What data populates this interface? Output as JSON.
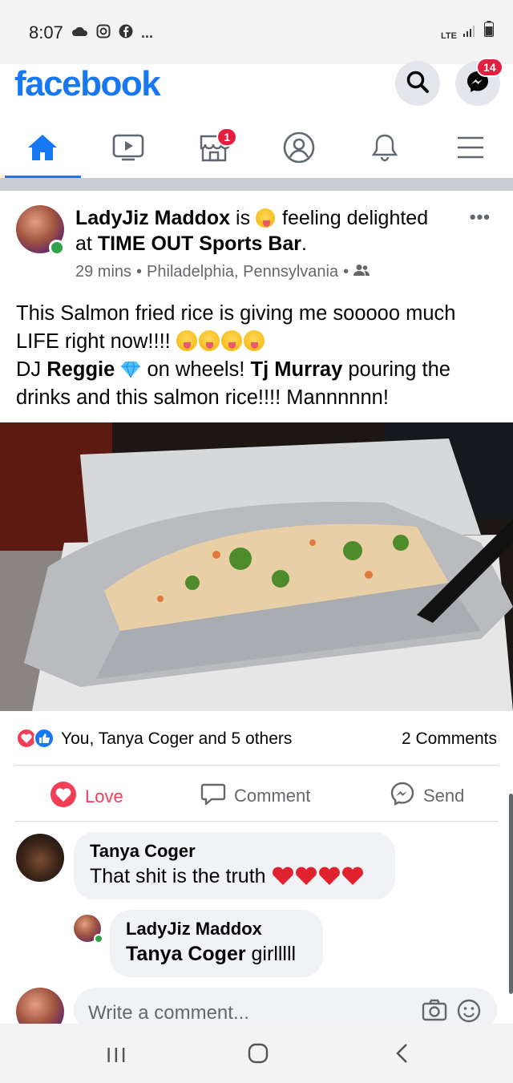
{
  "status_bar": {
    "time": "8:07",
    "left_icons": [
      "cloud-icon",
      "instagram-icon",
      "facebook-icon",
      "more-icon"
    ],
    "network": "LTE",
    "more_indicator": "..."
  },
  "header": {
    "logo": "facebook",
    "messenger_badge": "14",
    "colors": {
      "brand": "#1877f2",
      "badge": "#e41e3f"
    }
  },
  "nav": {
    "tabs": [
      {
        "icon": "home-icon",
        "active": true
      },
      {
        "icon": "watch-icon",
        "active": false
      },
      {
        "icon": "marketplace-icon",
        "badge": "1",
        "active": false
      },
      {
        "icon": "profile-icon",
        "active": false
      },
      {
        "icon": "bell-icon",
        "active": false
      },
      {
        "icon": "menu-icon",
        "active": false
      }
    ]
  },
  "post": {
    "author": "LadyJiz Maddox",
    "is_word": "is",
    "feeling": "feeling delighted",
    "at_word": "at",
    "place": "TIME OUT Sports Bar",
    "place_suffix": ".",
    "time_ago": "29 mins",
    "separator": "•",
    "location": "Philadelphia, Pennsylvania",
    "more": "•••",
    "text_line1": "This Salmon fried rice is giving me sooooo much LIFE right now!!!!",
    "text_dj": "DJ",
    "text_reggie": "Reggie",
    "text_on_wheels": "on wheels!",
    "text_tj": "Tj Murray",
    "text_rest": "pouring the drinks and this salmon rice!!!! Mannnnnn!"
  },
  "reactions": {
    "summary": "You, Tanya Coger and 5 others",
    "comments_count": "2 Comments"
  },
  "actions": {
    "love": "Love",
    "comment": "Comment",
    "send": "Send"
  },
  "comments": [
    {
      "name": "Tanya Coger",
      "text": "That shit is the truth"
    },
    {
      "name": "LadyJiz Maddox",
      "mention": "Tanya Coger",
      "text": "girlllll"
    }
  ],
  "composer": {
    "placeholder": "Write a comment..."
  },
  "android_nav": {
    "recents": "III"
  }
}
